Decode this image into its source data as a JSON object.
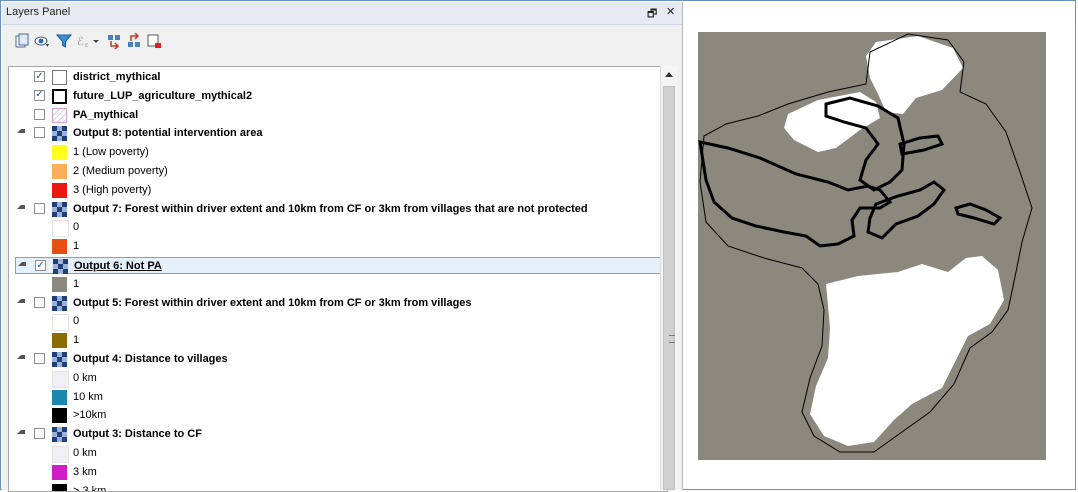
{
  "panel": {
    "title": "Layers Panel",
    "controls": {
      "float": "🗗",
      "close": "✕"
    }
  },
  "toolbar": {
    "icons": [
      "open-layer-styling-icon",
      "manage-map-themes-icon",
      "filter-legend-icon",
      "filter-expression-icon",
      "expand-all-icon",
      "collapse-all-icon",
      "remove-layer-icon"
    ]
  },
  "layers": [
    {
      "name": "district_mythical",
      "checked": true,
      "symbol": "white-fill"
    },
    {
      "name": "future_LUP_agriculture_mythical2",
      "checked": true,
      "symbol": "black-outline"
    },
    {
      "name": "PA_mythical",
      "checked": false,
      "symbol": "hatched-pink"
    },
    {
      "name": "Output 8: potential intervention area",
      "checked": false,
      "symbol": "raster",
      "legend": [
        {
          "label": "1 (Low poverty)",
          "color": "#ffff1a"
        },
        {
          "label": "2 (Medium poverty)",
          "color": "#ffae5a"
        },
        {
          "label": "3 (High poverty)",
          "color": "#e81a0f"
        }
      ]
    },
    {
      "name": "Output 7: Forest within driver extent and 10km from CF or 3km from villages that are not protected",
      "checked": false,
      "symbol": "raster",
      "legend": [
        {
          "label": "0",
          "color": "#ffffff"
        },
        {
          "label": "1",
          "color": "#e84e12"
        }
      ]
    },
    {
      "name": "Output 6: Not PA",
      "checked": true,
      "symbol": "raster",
      "selected": true,
      "legend": [
        {
          "label": "1",
          "color": "#8b887d"
        }
      ]
    },
    {
      "name": "Output 5: Forest within driver extent and 10km from CF or 3km from villages",
      "checked": false,
      "symbol": "raster",
      "legend": [
        {
          "label": "0",
          "color": "#ffffff"
        },
        {
          "label": "1",
          "color": "#8a6c00"
        }
      ]
    },
    {
      "name": "Output 4: Distance to villages",
      "checked": false,
      "symbol": "raster",
      "legend": [
        {
          "label": "0 km",
          "color": "#f2eef6"
        },
        {
          "label": "10 km",
          "color": "#1b86ae"
        },
        {
          "label": ">10km",
          "color": "#000000"
        }
      ]
    },
    {
      "name": "Output 3: Distance to CF",
      "checked": false,
      "symbol": "raster",
      "legend": [
        {
          "label": "0 km",
          "color": "#f2eef6"
        },
        {
          "label": "3 km",
          "color": "#d01bc6"
        },
        {
          "label": "> 3 km",
          "color": "#000000"
        }
      ]
    }
  ],
  "map": {
    "background": "#8b887d",
    "fill_color": "#ffffff",
    "outline_color": "#000000"
  }
}
